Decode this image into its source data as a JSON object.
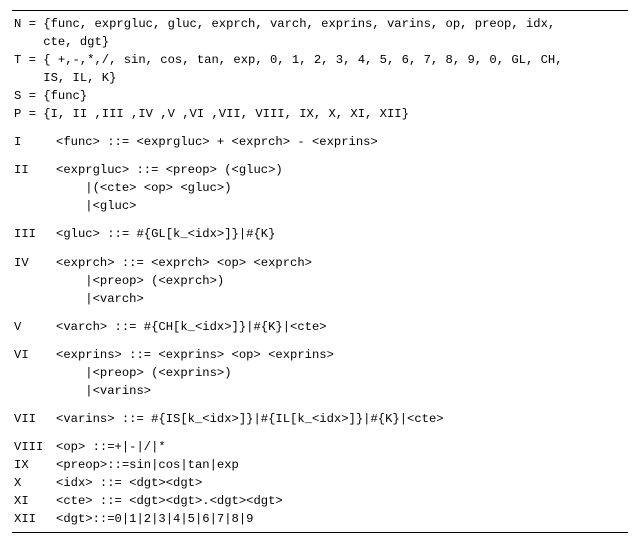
{
  "header": {
    "N": "N = {func, exprgluc, gluc, exprch, varch, exprins, varins, op, preop, idx,\n    cte, dgt}",
    "T": "T = { +,-,*,/, sin, cos, tan, exp, 0, 1, 2, 3, 4, 5, 6, 7, 8, 9, 0, GL, CH,\n    IS, IL, K}",
    "S": "S = {func}",
    "P": "P = {I, II ,III ,IV ,V ,VI ,VII, VIII, IX, X, XI, XII}"
  },
  "rules": {
    "I": "<func> ::= <exprgluc> + <exprch> - <exprins>",
    "II": "<exprgluc> ::= <preop> (<gluc>)\n    |(<cte> <op> <gluc>)\n    |<gluc>",
    "III": "<gluc> ::= #{GL[k_<idx>]}|#{K}",
    "IV": "<exprch> ::= <exprch> <op> <exprch>\n    |<preop> (<exprch>)\n    |<varch>",
    "V": "<varch> ::= #{CH[k_<idx>]}|#{K}|<cte>",
    "VI": "<exprins> ::= <exprins> <op> <exprins>\n    |<preop> (<exprins>)\n    |<varins>",
    "VII": "<varins> ::= #{IS[k_<idx>]}|#{IL[k_<idx>]}|#{K}|<cte>",
    "VIII": "<op> ::=+|-|/|*",
    "IX": "<preop>::=sin|cos|tan|exp",
    "X": "<idx> ::= <dgt><dgt>",
    "XI": "<cte> ::= <dgt><dgt>.<dgt><dgt>",
    "XII": "<dgt>::=0|1|2|3|4|5|6|7|8|9"
  },
  "labels": {
    "I": "I",
    "II": "II",
    "III": "III",
    "IV": "IV",
    "V": "V",
    "VI": "VI",
    "VII": "VII",
    "VIII": "VIII",
    "IX": "IX",
    "X": "X",
    "XI": "XI",
    "XII": "XII"
  }
}
